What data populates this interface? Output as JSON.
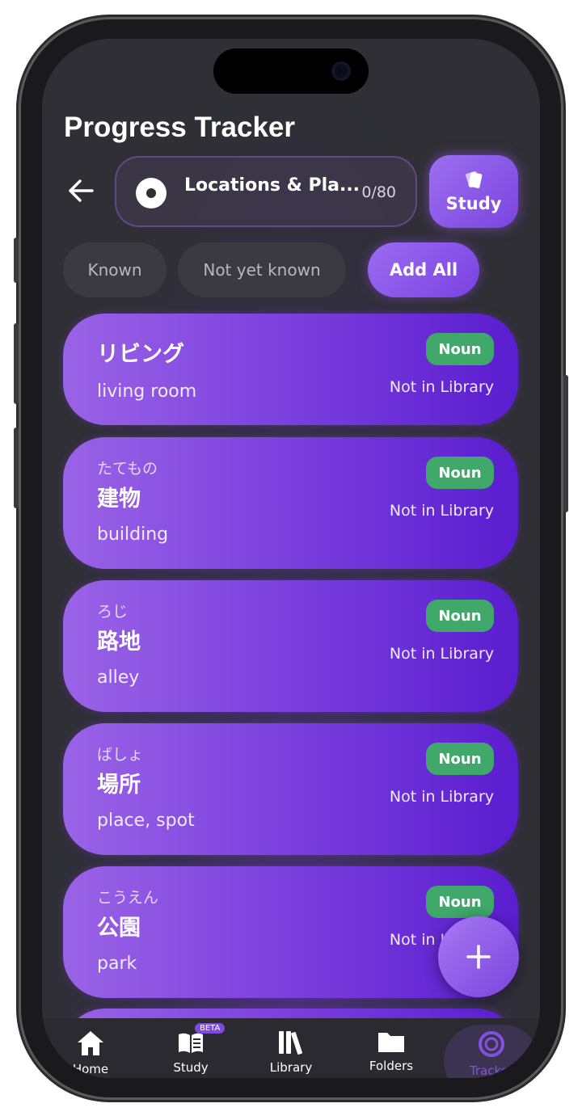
{
  "header": {
    "title": "Progress Tracker"
  },
  "deck": {
    "name": "Locations & Pla...",
    "count": "0/80"
  },
  "study_button": {
    "label": "Study"
  },
  "filters": [
    {
      "label": "Known"
    },
    {
      "label": "Not yet known"
    },
    {
      "label": "Add All"
    }
  ],
  "cards": [
    {
      "kana": "",
      "word": "リビング",
      "meaning": "living room",
      "badge": "Noun",
      "status": "Not in Library"
    },
    {
      "kana": "たてもの",
      "word": "建物",
      "meaning": "building",
      "badge": "Noun",
      "status": "Not in Library"
    },
    {
      "kana": "ろじ",
      "word": "路地",
      "meaning": "alley",
      "badge": "Noun",
      "status": "Not in Library"
    },
    {
      "kana": "ばしょ",
      "word": "場所",
      "meaning": "place, spot",
      "badge": "Noun",
      "status": "Not in Library"
    },
    {
      "kana": "こうえん",
      "word": "公園",
      "meaning": "park",
      "badge": "Noun",
      "status": "Not in Library"
    }
  ],
  "nav": {
    "items": [
      {
        "label": "Home",
        "icon": "home-icon"
      },
      {
        "label": "Study",
        "icon": "book-icon",
        "badge": "BETA"
      },
      {
        "label": "Library",
        "icon": "library-icon"
      },
      {
        "label": "Folders",
        "icon": "folder-icon"
      },
      {
        "label": "Tracker",
        "icon": "tracker-icon"
      }
    ]
  },
  "colors": {
    "accent": "#7a44e0",
    "badge_green": "#3fa86a",
    "background": "#2f2f35"
  }
}
